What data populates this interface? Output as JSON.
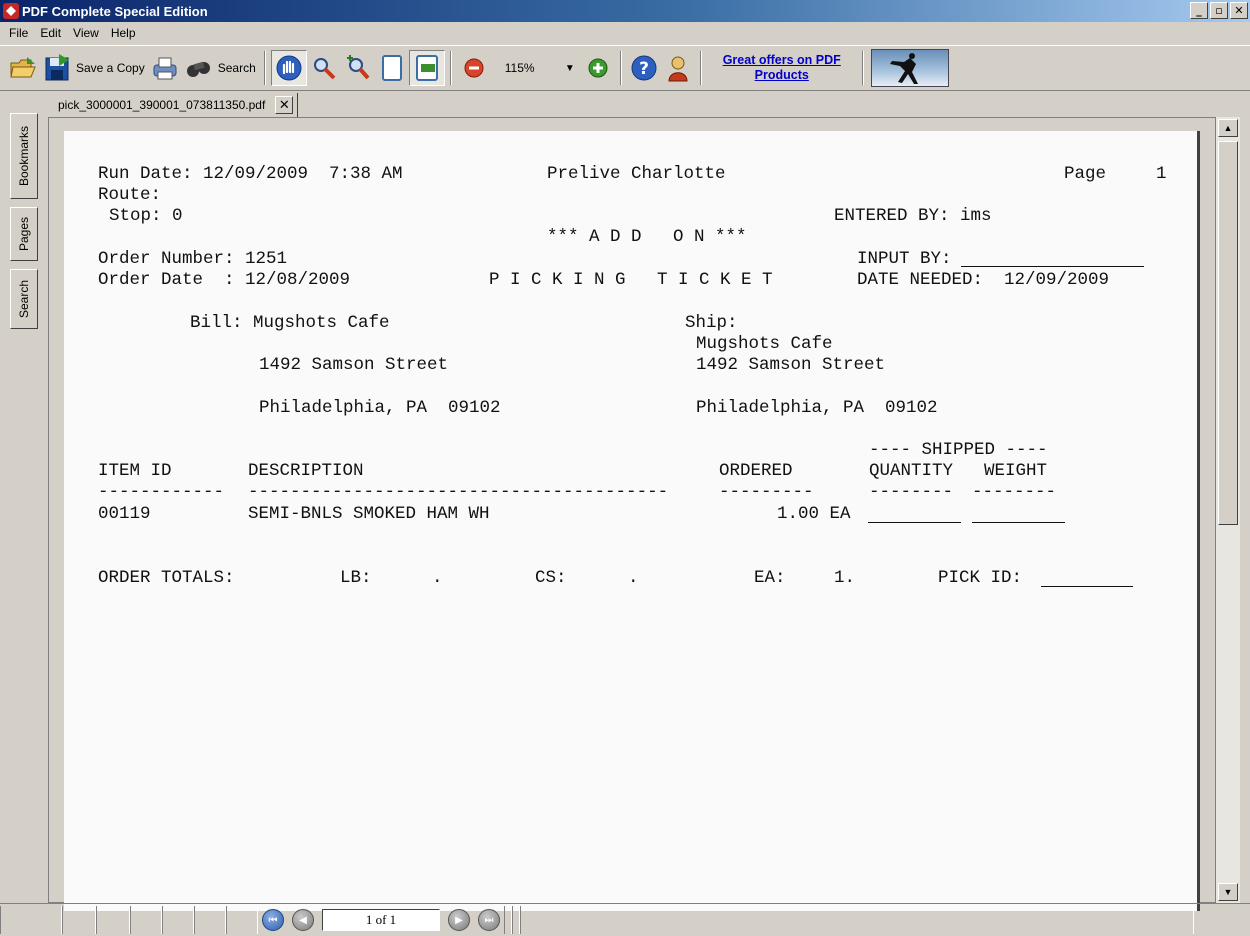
{
  "window": {
    "title": "PDF Complete Special Edition",
    "btn_min": "_",
    "btn_max": "▫",
    "btn_close": "✕"
  },
  "menu": [
    "File",
    "Edit",
    "View",
    "Help"
  ],
  "toolbar": {
    "save_copy": "Save a Copy",
    "search": "Search",
    "zoom": "115%",
    "zoom_arrow": "▼",
    "ad_line1": "Great offers on PDF",
    "ad_line2": "Products"
  },
  "sidetabs": [
    "Bookmarks",
    "Pages",
    "Search"
  ],
  "doc_tab": {
    "filename": "pick_3000001_390001_073811350.pdf",
    "close": "✕"
  },
  "ticket": {
    "run_date": "Run Date: 12/09/2009  7:38 AM",
    "company": "Prelive Charlotte",
    "page_label": "Page",
    "page_num": "1",
    "route": "Route:",
    "stop": "Stop: 0",
    "entered_by": "ENTERED BY: ims",
    "add_on": "*** A D D   O N ***",
    "order_number": "Order Number: 1251",
    "input_by": "INPUT BY:",
    "order_date": "Order Date  : 12/08/2009",
    "picking_ticket": "P I C K I N G   T I C K E T",
    "date_needed": "DATE NEEDED:  12/09/2009",
    "bill_label": "Bill: Mugshots Cafe",
    "bill_street": "1492 Samson Street",
    "bill_city": "Philadelphia, PA  09102",
    "ship_label": "Ship:",
    "ship_name": "Mugshots Cafe",
    "ship_street": "1492 Samson Street",
    "ship_city": "Philadelphia, PA  09102",
    "shipped_header": "---- SHIPPED ----",
    "col_item": "ITEM ID",
    "col_desc": "DESCRIPTION",
    "col_ordered": "ORDERED",
    "col_qty": "QUANTITY",
    "col_weight": "WEIGHT",
    "dash_item": "------------",
    "dash_desc": "----------------------------------------",
    "dash_ordered": "---------",
    "dash_qty": "--------",
    "dash_weight": "--------",
    "rows": [
      {
        "item": "00119",
        "desc": "SEMI-BNLS SMOKED HAM WH",
        "ordered": "1.00 EA"
      }
    ],
    "totals_label": "ORDER TOTALS:",
    "lb": "LB:",
    "lb_val": ".",
    "cs": "CS:",
    "cs_val": ".",
    "ea": "EA:",
    "ea_val": "1.",
    "pick_id": "PICK ID:"
  },
  "status": {
    "page_indicator": "1 of 1"
  }
}
